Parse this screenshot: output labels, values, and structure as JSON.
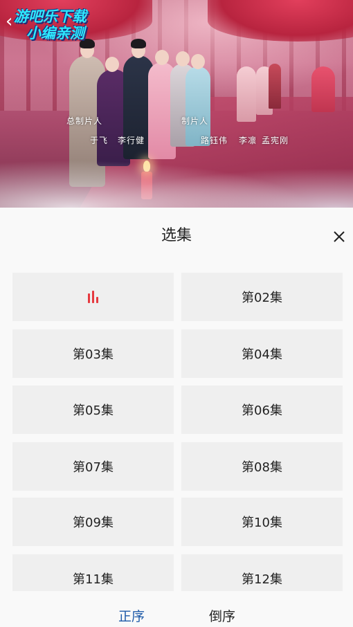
{
  "video": {
    "watermark_line1": "游吧乐下载",
    "watermark_line2": "小编亲测",
    "credits": [
      "总制片人",
      "于飞",
      "李行健",
      "制片人",
      "路钰伟",
      "李凛",
      "孟宪刚"
    ]
  },
  "panel": {
    "title": "选集",
    "episodes": [
      {
        "label": "",
        "playing": true
      },
      {
        "label": "第02集"
      },
      {
        "label": "第03集"
      },
      {
        "label": "第04集"
      },
      {
        "label": "第05集"
      },
      {
        "label": "第06集"
      },
      {
        "label": "第07集"
      },
      {
        "label": "第08集"
      },
      {
        "label": "第09集"
      },
      {
        "label": "第10集"
      },
      {
        "label": "第11集"
      },
      {
        "label": "第12集"
      }
    ],
    "sort_asc": "正序",
    "sort_desc": "倒序",
    "colors": {
      "accent": "#e5393f",
      "active_sort": "#1e5aa8",
      "tile": "#efefef"
    }
  }
}
